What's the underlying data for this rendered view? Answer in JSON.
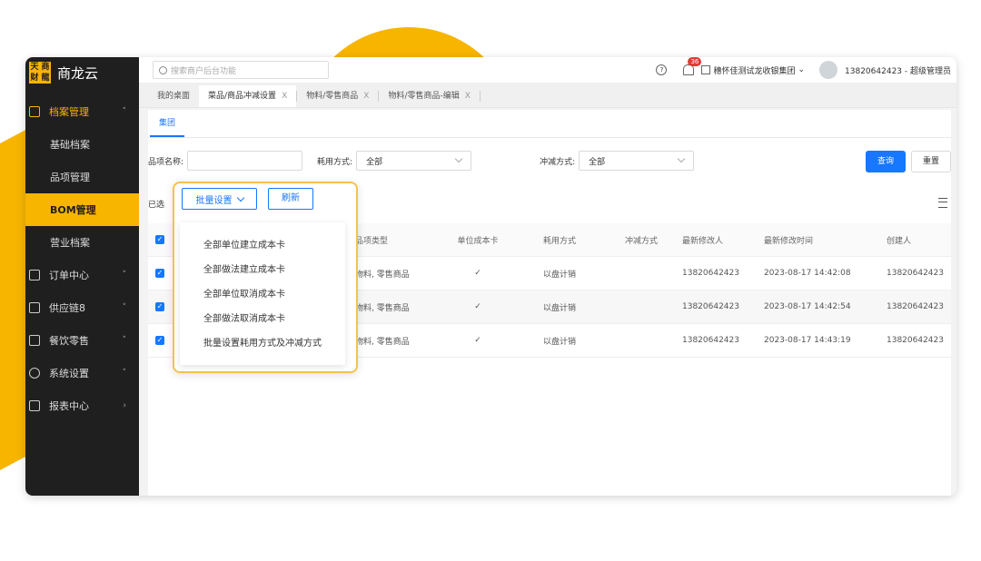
{
  "app": {
    "logo_chars": [
      "天",
      "商",
      "财",
      "龍"
    ],
    "name": "商龙云"
  },
  "sidebar": {
    "items": [
      {
        "label": "档案管理",
        "arrow": "˄"
      },
      {
        "label": "基础档案"
      },
      {
        "label": "品项管理"
      },
      {
        "label": "BOM管理"
      },
      {
        "label": "营业档案"
      },
      {
        "label": "订单中心",
        "arrow": "˅"
      },
      {
        "label": "供应链8",
        "arrow": "˅"
      },
      {
        "label": "餐饮零售",
        "arrow": "˅"
      },
      {
        "label": "系统设置",
        "arrow": "˅"
      },
      {
        "label": "报表中心",
        "arrow": "›"
      }
    ]
  },
  "topbar": {
    "search_placeholder": "搜索商户后台功能",
    "help": "?",
    "badge": "36",
    "org": "穗怀佳测试龙收银集团",
    "user": "13820642423 - 超级管理员"
  },
  "tabs": [
    {
      "label": "我的桌面",
      "close": ""
    },
    {
      "label": "菜品/商品冲减设置",
      "close": "X"
    },
    {
      "label": "物料/零售商品",
      "close": "X"
    },
    {
      "label": "物料/零售商品-编辑",
      "close": "X"
    }
  ],
  "subtab": "集团",
  "filters": {
    "name_label": "品项名称:",
    "usage_label": "耗用方式:",
    "usage_value": "全部",
    "offset_label": "冲减方式:",
    "offset_value": "全部",
    "query": "查询",
    "reset": "重置"
  },
  "selected_prefix": "已选",
  "table": {
    "headers": [
      "品项类型",
      "单位成本卡",
      "耗用方式",
      "冲减方式",
      "最新修改人",
      "最新修改时间",
      "创建人"
    ],
    "rows": [
      {
        "type": "物料, 零售商品",
        "cost_card": "✓",
        "usage": "以盘计销",
        "offset": "",
        "modifier": "13820642423",
        "modified": "2023-08-17 14:42:08",
        "creator": "13820642423"
      },
      {
        "type": "物料, 零售商品",
        "cost_card": "✓",
        "usage": "以盘计销",
        "offset": "",
        "modifier": "13820642423",
        "modified": "2023-08-17 14:42:54",
        "creator": "13820642423"
      },
      {
        "type": "物料, 零售商品",
        "cost_card": "✓",
        "usage": "以盘计销",
        "offset": "",
        "modifier": "13820642423",
        "modified": "2023-08-17 14:43:19",
        "creator": "13820642423"
      }
    ]
  },
  "popup": {
    "batch_button": "批量设置",
    "refresh_button": "刷新",
    "menu": [
      "全部单位建立成本卡",
      "全部做法建立成本卡",
      "全部单位取消成本卡",
      "全部做法取消成本卡",
      "批量设置耗用方式及冲减方式"
    ]
  },
  "colors": {
    "accent": "#f7b500",
    "primary": "#1677ff",
    "sidebar_bg": "#1f1f1f"
  }
}
